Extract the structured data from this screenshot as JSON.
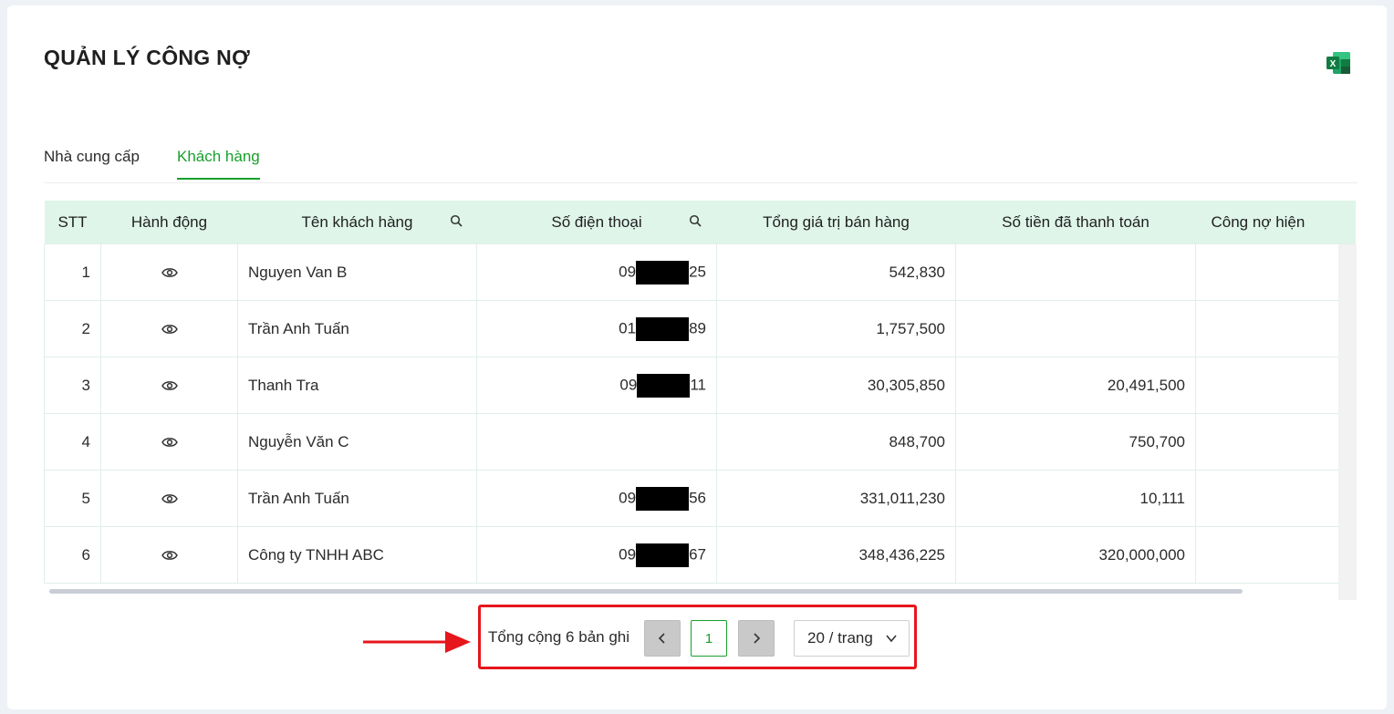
{
  "page": {
    "title": "QUẢN LÝ CÔNG NỢ",
    "export_icon": "excel-icon"
  },
  "tabs": [
    {
      "label": "Nhà cung cấp",
      "active": false
    },
    {
      "label": "Khách hàng",
      "active": true
    }
  ],
  "table": {
    "headers": [
      "STT",
      "Hành động",
      "Tên khách hàng",
      "Số điện thoại",
      "Tổng giá trị bán hàng",
      "Số tiền đã thanh toán",
      "Công nợ hiện"
    ],
    "rows": [
      {
        "stt": "1",
        "name": "Nguyen Van B",
        "phone_prefix": "09",
        "phone_suffix": "25",
        "total": "542,830",
        "paid": ""
      },
      {
        "stt": "2",
        "name": "Trần Anh Tuấn",
        "phone_prefix": "01",
        "phone_suffix": "89",
        "total": "1,757,500",
        "paid": ""
      },
      {
        "stt": "3",
        "name": "Thanh Tra",
        "phone_prefix": "09",
        "phone_suffix": "11",
        "total": "30,305,850",
        "paid": "20,491,500"
      },
      {
        "stt": "4",
        "name": "Nguyễn Văn C",
        "phone_prefix": "",
        "phone_suffix": "",
        "total": "848,700",
        "paid": "750,700"
      },
      {
        "stt": "5",
        "name": "Trần Anh Tuấn",
        "phone_prefix": "09",
        "phone_suffix": "56",
        "total": "331,011,230",
        "paid": "10,111"
      },
      {
        "stt": "6",
        "name": "Công ty TNHH ABC",
        "phone_prefix": "09",
        "phone_suffix": "67",
        "total": "348,436,225",
        "paid": "320,000,000"
      }
    ]
  },
  "pagination": {
    "total_text": "Tổng cộng 6 bản ghi",
    "current_page": "1",
    "page_size": "20 / trang"
  },
  "colors": {
    "accent": "#18a02b",
    "header_bg": "#dff5ea",
    "highlight": "#e5161c"
  }
}
